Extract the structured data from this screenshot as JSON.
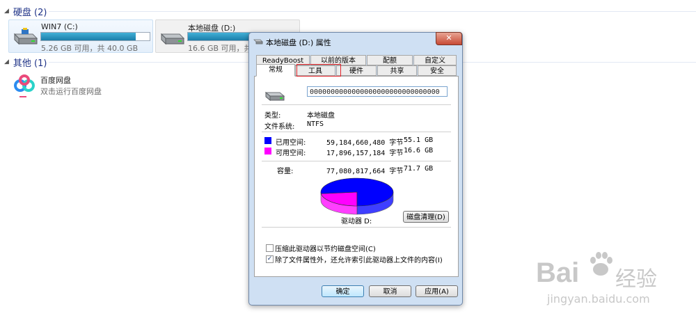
{
  "explorer": {
    "group_hdd": {
      "label": "硬盘 (2)"
    },
    "group_other": {
      "label": "其他 (1)"
    },
    "drives": [
      {
        "name": "WIN7 (C:)",
        "info": "5.26 GB 可用，共 40.0 GB",
        "used_fraction": 0.87
      },
      {
        "name": "本地磁盘 (D:)",
        "info": "16.6 GB 可用，共 7",
        "used_fraction": 0.77
      }
    ],
    "other_item": {
      "name": "百度网盘",
      "desc": "双击运行百度网盘"
    }
  },
  "dialog": {
    "title": "本地磁盘 (D:) 属性",
    "close_label": "✕",
    "tabs_top": [
      "ReadyBoost",
      "以前的版本",
      "配额",
      "自定义"
    ],
    "tabs_bottom": [
      "常规",
      "工具",
      "硬件",
      "共享",
      "安全"
    ],
    "volume_label": "0000000000000000000000000000000",
    "type_label": "类型:",
    "type_value": "本地磁盘",
    "fs_label": "文件系统:",
    "fs_value": "NTFS",
    "used": {
      "label": "已用空间:",
      "bytes": "59,184,660,480 字节",
      "size": "55.1 GB",
      "color": "#0000ff"
    },
    "free": {
      "label": "可用空间:",
      "bytes": "17,896,157,184 字节",
      "size": "16.6 GB",
      "color": "#ff00ff"
    },
    "capacity": {
      "label": "容量:",
      "bytes": "77,080,817,664 字节",
      "size": "71.7 GB"
    },
    "used_fraction": 0.768,
    "drive_label": "驱动器 D:",
    "cleanup_button": "磁盘清理(D)",
    "compress_label": "压缩此驱动器以节约磁盘空间(C)",
    "compress_checked": "",
    "index_label": "除了文件属性外，还允许索引此驱动器上文件的内容(I)",
    "index_checked": "✓",
    "ok_button": "确定",
    "cancel_button": "取消",
    "apply_button": "应用(A)"
  },
  "watermark": {
    "logo": "Bai",
    "logo2": "经验",
    "url": "jingyan.baidu.com"
  }
}
